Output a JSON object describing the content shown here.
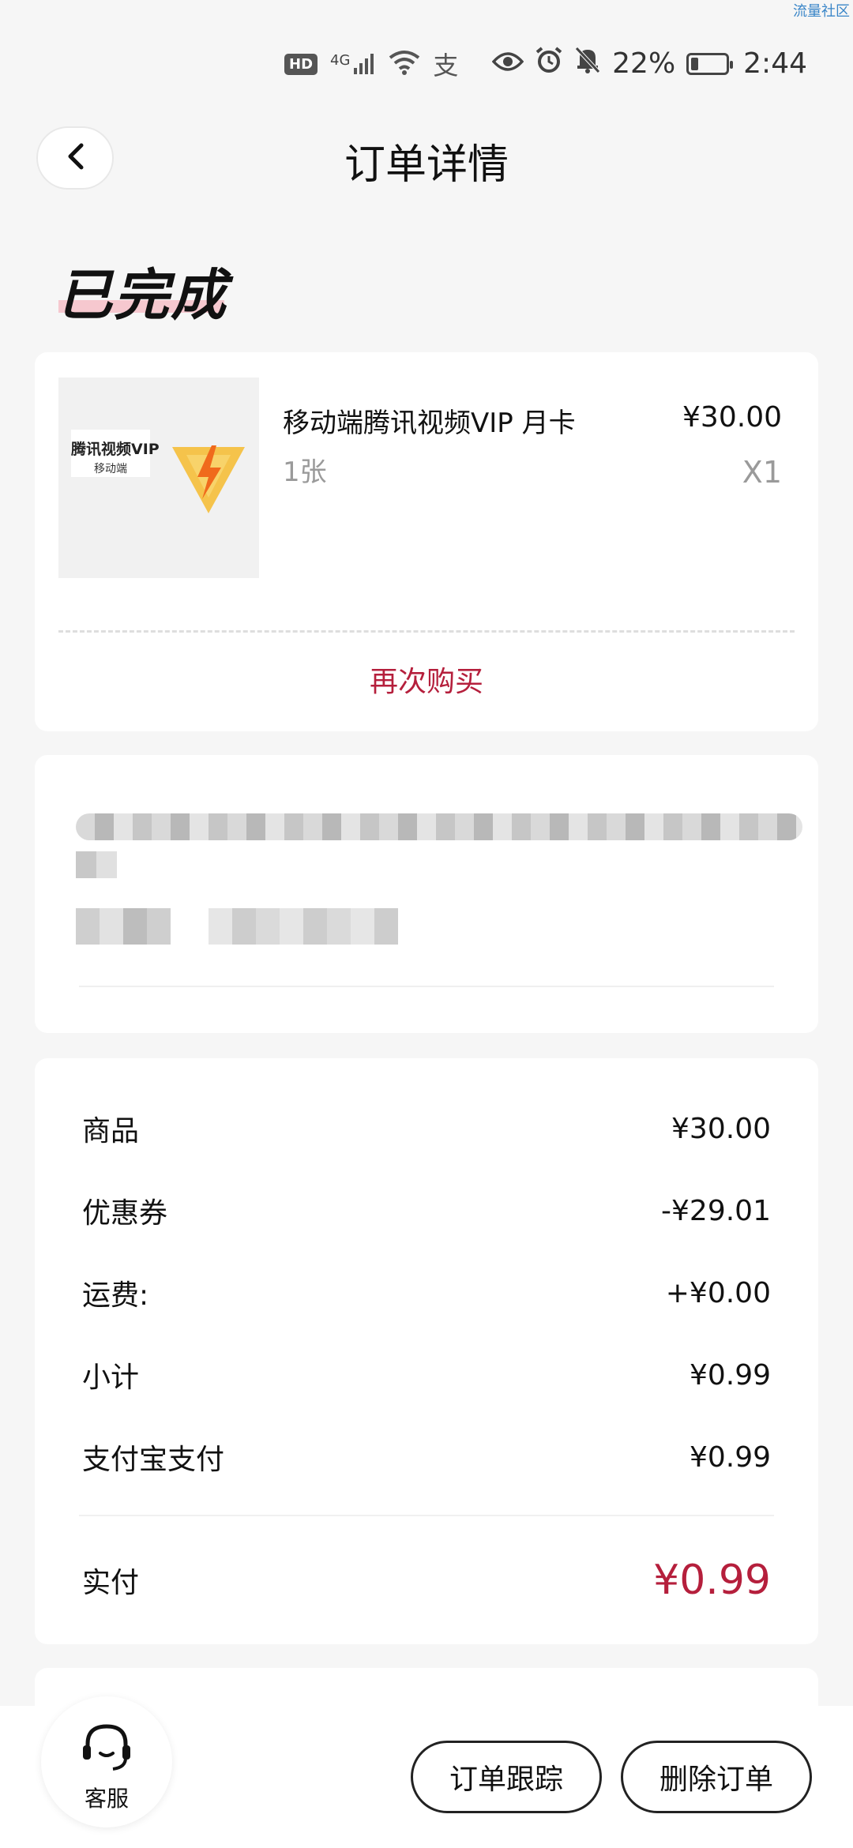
{
  "watermark": "流量社区",
  "status_bar": {
    "hd": "HD",
    "network": "4G",
    "alipay_glyph": "支",
    "battery_percent": "22%",
    "battery_level": 0.22,
    "time": "2:44",
    "icons": [
      "hd-icon",
      "signal-icon",
      "wifi-icon",
      "alipay-icon",
      "eye-icon",
      "alarm-icon",
      "bell-off-icon",
      "battery-icon"
    ]
  },
  "header": {
    "title": "订单详情",
    "back_icon": "chevron-left-icon"
  },
  "order_status": "已完成",
  "product": {
    "thumb_title": "腾讯视频VIP",
    "thumb_subtitle": "移动端",
    "name": "移动端腾讯视频VIP 月卡",
    "spec": "1张",
    "price": "¥30.00",
    "quantity": "X1",
    "rebuy_label": "再次购买",
    "accent_color": "#b51f3c"
  },
  "summary": {
    "rows": [
      {
        "label": "商品",
        "value": "¥30.00"
      },
      {
        "label": "优惠券",
        "value": "-¥29.01"
      },
      {
        "label": "运费:",
        "value": "+¥0.00"
      },
      {
        "label": "小计",
        "value": "¥0.99"
      },
      {
        "label": "支付宝支付",
        "value": "¥0.99"
      }
    ],
    "total_label": "实付",
    "total_value": "¥0.99"
  },
  "bottom": {
    "service_label": "客服",
    "track_label": "订单跟踪",
    "delete_label": "删除订单"
  }
}
